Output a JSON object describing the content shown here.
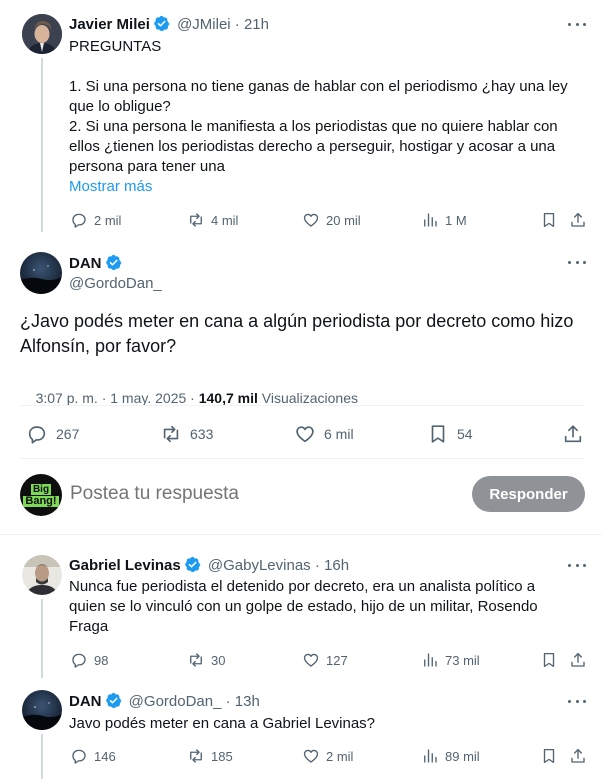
{
  "post1": {
    "name": "Javier Milei",
    "handle": "@JMilei",
    "time": "· 21h",
    "line_title": "PREGUNTAS",
    "line_1": "1. Si una persona no tiene ganas de hablar con el periodismo ¿hay una ley\nque lo obligue?",
    "line_2": "2. Si una persona le manifiesta a los periodistas que no quiere hablar con\nellos ¿tienen los periodistas derecho a perseguir, hostigar y acosar a una\npersona para tener una",
    "show_more": "Mostrar más",
    "replies": "2 mil",
    "reposts": "4 mil",
    "likes": "20 mil",
    "views": "1 M"
  },
  "main": {
    "name": "DAN",
    "handle": "@GordoDan_",
    "text": "¿Javo podés meter en cana a algún periodista por decreto como hizo\nAlfonsín, por favor?",
    "timestamp": "3:07 p. m. · 1 may. 2025 · ",
    "views_count": "140,7 mil",
    "views_label": " Visualizaciones",
    "replies": "267",
    "reposts": "633",
    "likes": "6 mil",
    "bookmarks": "54"
  },
  "compose": {
    "avatar_text_1": "Big",
    "avatar_text_2": "Bang!",
    "placeholder": "Postea tu respuesta",
    "button": "Responder"
  },
  "reply1": {
    "name": "Gabriel Levinas",
    "handle": "@GabyLevinas",
    "time": "· 16h",
    "text": "Nunca fue periodista el detenido por decreto, era un analista político a\nquien se lo vinculó con un golpe de estado, hijo de un militar, Rosendo\nFraga",
    "replies": "98",
    "reposts": "30",
    "likes": "127",
    "views": "73 mil"
  },
  "reply2": {
    "name": "DAN",
    "handle": "@GordoDan_",
    "time": "· 13h",
    "text": "Javo podés meter en cana a Gabriel Levinas?",
    "replies": "146",
    "reposts": "185",
    "likes": "2 mil",
    "views": "89 mil"
  },
  "colors": {
    "verified": "#1d9bf0",
    "link": "#1d9bf0",
    "muted": "#536471",
    "button": "#8f9398"
  }
}
